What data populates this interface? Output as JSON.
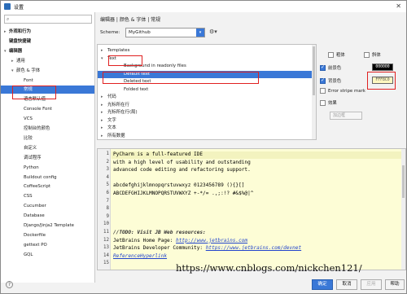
{
  "window": {
    "title": "设置",
    "close_glyph": "✕"
  },
  "search": {
    "placeholder": "",
    "icon": "search-icon"
  },
  "sidebar": {
    "items": [
      {
        "label": "外观和行为",
        "arrow": "▸",
        "bold": true
      },
      {
        "label": "键盘快捷键",
        "arrow": "",
        "bold": true
      },
      {
        "label": "编辑器",
        "arrow": "▾",
        "bold": true
      },
      {
        "label": "通用",
        "arrow": "▸",
        "bold": false
      },
      {
        "label": "颜色 & 字体",
        "arrow": "▾",
        "bold": false
      },
      {
        "label": "Font",
        "arrow": "",
        "bold": false
      },
      {
        "label": "常规",
        "arrow": "",
        "bold": false
      },
      {
        "label": "语言默认值",
        "arrow": "",
        "bold": false
      },
      {
        "label": "Console Font",
        "arrow": "",
        "bold": false
      },
      {
        "label": "VCS",
        "arrow": "",
        "bold": false
      },
      {
        "label": "控制台的颜色",
        "arrow": "",
        "bold": false
      },
      {
        "label": "比较",
        "arrow": "",
        "bold": false
      },
      {
        "label": "自定义",
        "arrow": "",
        "bold": false
      },
      {
        "label": "调试程序",
        "arrow": "",
        "bold": false
      },
      {
        "label": "Python",
        "arrow": "",
        "bold": false
      },
      {
        "label": "Buildout config",
        "arrow": "",
        "bold": false
      },
      {
        "label": "CoffeeScript",
        "arrow": "",
        "bold": false
      },
      {
        "label": "CSS",
        "arrow": "",
        "bold": false
      },
      {
        "label": "Cucumber",
        "arrow": "",
        "bold": false
      },
      {
        "label": "Database",
        "arrow": "",
        "bold": false
      },
      {
        "label": "Django/Jinja2 Template",
        "arrow": "",
        "bold": false
      },
      {
        "label": "Dockerfile",
        "arrow": "",
        "bold": false
      },
      {
        "label": "gettext PO",
        "arrow": "",
        "bold": false
      },
      {
        "label": "GQL",
        "arrow": "",
        "bold": false
      }
    ],
    "selected_index": 6
  },
  "breadcrumb": "编辑器 | 颜色 & 字体 | 常规",
  "scheme": {
    "label": "Scheme:",
    "value": "MyGithub",
    "dropdown_glyph": "▾",
    "gear_icon": "gear-icon",
    "gear_glyph": "⚙▾"
  },
  "attr_tree": {
    "items": [
      {
        "label": "Templates",
        "arrow": "▸",
        "indent": 0
      },
      {
        "label": "Text",
        "arrow": "▾",
        "indent": 0
      },
      {
        "label": "Background in readonly files",
        "arrow": "",
        "indent": 1
      },
      {
        "label": "Default text",
        "arrow": "",
        "indent": 1
      },
      {
        "label": "Deleted text",
        "arrow": "",
        "indent": 1
      },
      {
        "label": "Folded text",
        "arrow": "",
        "indent": 1
      },
      {
        "label": "代码",
        "arrow": "▸",
        "indent": 0
      },
      {
        "label": "光标所在行",
        "arrow": "▸",
        "indent": 0
      },
      {
        "label": "光标所在行(局)",
        "arrow": "▸",
        "indent": 0
      },
      {
        "label": "文字",
        "arrow": "▸",
        "indent": 0
      },
      {
        "label": "文本",
        "arrow": "▸",
        "indent": 0
      },
      {
        "label": "所有数据",
        "arrow": "▸",
        "indent": 0
      }
    ],
    "selected_index": 3
  },
  "options": {
    "bold": {
      "label": "粗体",
      "checked": false
    },
    "italic": {
      "label": "斜体",
      "checked": false
    },
    "foreground": {
      "label": "前景色",
      "checked": true,
      "value": "000000",
      "color": "#000000"
    },
    "background": {
      "label": "背景色",
      "checked": true,
      "value": "FFF8C0",
      "color": "#FFF8C0"
    },
    "error_stripe": {
      "label": "Error stripe mark",
      "checked": false
    },
    "effects": {
      "label": "效果",
      "checked": false
    },
    "effects_combo": "加边框"
  },
  "editor": {
    "line_numbers": [
      "1",
      "2",
      "3",
      "4",
      "5",
      "6",
      "7",
      "8",
      "9",
      "10",
      "11",
      "12",
      "13",
      "14",
      "15"
    ],
    "lines": [
      {
        "text": "PyCharm is a full-featured IDE",
        "type": "plain"
      },
      {
        "text": "with a high level of usability and outstanding",
        "type": "plain"
      },
      {
        "text": "advanced code editing and refactoring support.",
        "type": "plain"
      },
      {
        "text": "",
        "type": "plain"
      },
      {
        "text": "abcdefghijklmnopqrstuvwxyz 0123456789 (){}[]",
        "type": "plain"
      },
      {
        "text": "ABCDEFGHIJKLMNOPQRSTUVWXYZ +-*/= .,;:!? #&$%@|^",
        "type": "plain"
      },
      {
        "text": "",
        "type": "plain"
      },
      {
        "text": "",
        "type": "plain"
      },
      {
        "text": "",
        "type": "plain"
      },
      {
        "text": "",
        "type": "plain"
      },
      {
        "text": "//TODO: Visit JB Web resources:",
        "type": "comment"
      },
      {
        "prefix": "JetBrains Home Page: ",
        "link": "http://www.jetbrains.com",
        "type": "link"
      },
      {
        "prefix": "JetBrains Developer Community: ",
        "link": "https://www.jetbrains.com/devnet",
        "type": "link"
      },
      {
        "prefix": "",
        "link": "ReferenceHyperlink",
        "type": "link"
      },
      {
        "text": "",
        "type": "plain"
      }
    ]
  },
  "watermark": "https://www.cnblogs.com/nickchen121/",
  "buttons": {
    "ok": "确定",
    "cancel": "取消",
    "apply": "应用",
    "help": "帮助",
    "help_icon": "?"
  }
}
